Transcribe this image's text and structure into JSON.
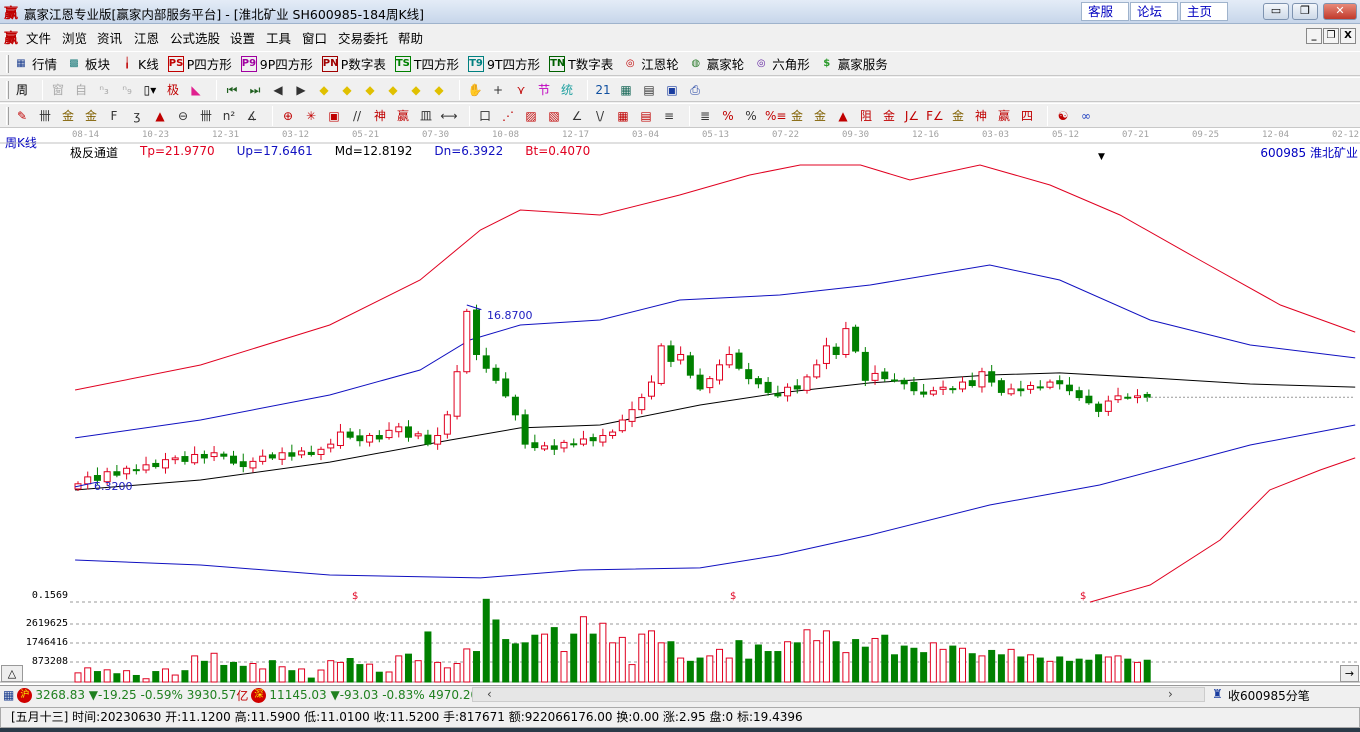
{
  "window": {
    "title": "赢家江恩专业版[赢家内部服务平台] - [淮北矿业  SH600985-184周K线]",
    "links": [
      "客服",
      "论坛",
      "主页"
    ],
    "controls": [
      "minimize",
      "restore",
      "close"
    ]
  },
  "menu": {
    "items": [
      "文件",
      "浏览",
      "资讯",
      "江恩",
      "公式选股",
      "设置",
      "工具",
      "窗口",
      "交易委托",
      "帮助"
    ]
  },
  "toolbar1": [
    {
      "label": "行情",
      "icon": "grid-icon",
      "glyph": "▦",
      "color": "#1a3d8f"
    },
    {
      "label": "板块",
      "icon": "blocks-icon",
      "glyph": "▩",
      "color": "#1a7a7a"
    },
    {
      "label": "K线",
      "icon": "kline-icon",
      "glyph": "╽",
      "color": "#c00000"
    },
    {
      "label": "P四方形",
      "icon": "ps-icon",
      "glyph": "PS",
      "color": "#c00000"
    },
    {
      "label": "9P四方形",
      "icon": "p9-icon",
      "glyph": "P9",
      "color": "#a000a0"
    },
    {
      "label": "P数字表",
      "icon": "pn-icon",
      "glyph": "PN",
      "color": "#a00000"
    },
    {
      "label": "T四方形",
      "icon": "ts-icon",
      "glyph": "TS",
      "color": "#008000"
    },
    {
      "label": "9T四方形",
      "icon": "t9-icon",
      "glyph": "T9",
      "color": "#008080"
    },
    {
      "label": "T数字表",
      "icon": "tn-icon",
      "glyph": "TN",
      "color": "#006000"
    },
    {
      "label": "江恩轮",
      "icon": "gann-wheel-icon",
      "glyph": "◎",
      "color": "#c00000"
    },
    {
      "label": "赢家轮",
      "icon": "winner-wheel-icon",
      "glyph": "◍",
      "color": "#2a7a2a"
    },
    {
      "label": "六角形",
      "icon": "hexagon-icon",
      "glyph": "◎",
      "color": "#6020a0"
    },
    {
      "label": "赢家服务",
      "icon": "dollar-icon",
      "glyph": "$",
      "color": "#2a9a2a"
    }
  ],
  "toolbar2": [
    {
      "name": "period-selector-icon",
      "glyph": "周▾",
      "color": "#000"
    },
    {
      "name": "sep"
    },
    {
      "name": "pattern-icon",
      "glyph": "窗",
      "color": "#aaa"
    },
    {
      "name": "self-icon",
      "glyph": "自",
      "color": "#aaa"
    },
    {
      "name": "n3-icon",
      "glyph": "ⁿ₃",
      "color": "#aaa"
    },
    {
      "name": "n9-icon",
      "glyph": "ⁿ₉",
      "color": "#aaa"
    },
    {
      "name": "candle-type-icon",
      "glyph": "▯▾",
      "color": "#000"
    },
    {
      "name": "extreme-icon",
      "glyph": "极",
      "color": "#c00000"
    },
    {
      "name": "histogram-icon",
      "glyph": "◣",
      "color": "#e0208f"
    },
    {
      "name": "sep"
    },
    {
      "name": "first-icon",
      "glyph": "⏮",
      "color": "#206020"
    },
    {
      "name": "last-icon",
      "glyph": "⏭",
      "color": "#206020"
    },
    {
      "name": "left-icon",
      "glyph": "◀",
      "color": "#333"
    },
    {
      "name": "right-icon",
      "glyph": "▶",
      "color": "#333"
    },
    {
      "name": "shift-left-icon",
      "glyph": "◆",
      "color": "#e0c000"
    },
    {
      "name": "shift-right-icon",
      "glyph": "◆",
      "color": "#e0c000"
    },
    {
      "name": "expand-icon",
      "glyph": "◆",
      "color": "#e0c000"
    },
    {
      "name": "shrink-icon",
      "glyph": "◆",
      "color": "#e0c000"
    },
    {
      "name": "zoom-v-icon",
      "glyph": "◆",
      "color": "#e0c000"
    },
    {
      "name": "zoom-all-icon",
      "glyph": "◆",
      "color": "#e0c000"
    },
    {
      "name": "sep"
    },
    {
      "name": "hand-icon",
      "glyph": "✋",
      "color": "#333"
    },
    {
      "name": "crosshair-icon",
      "glyph": "+",
      "color": "#333"
    },
    {
      "name": "draw-icon",
      "glyph": "⋎",
      "color": "#c00000"
    },
    {
      "name": "section-icon",
      "glyph": "节",
      "color": "#c000c0"
    },
    {
      "name": "stats-icon",
      "glyph": "统",
      "color": "#20a0a0"
    },
    {
      "name": "sep"
    },
    {
      "name": "calendar-icon",
      "glyph": "21",
      "color": "#1050a0"
    },
    {
      "name": "calculator-icon",
      "glyph": "▦",
      "color": "#1a6a5a"
    },
    {
      "name": "notes-icon",
      "glyph": "▤",
      "color": "#333"
    },
    {
      "name": "save-icon",
      "glyph": "▣",
      "color": "#1a3da0"
    },
    {
      "name": "print-icon",
      "glyph": "⎙",
      "color": "#1a3da0"
    }
  ],
  "toolbar3": [
    {
      "name": "pen-icon",
      "glyph": "✎",
      "color": "#c00000"
    },
    {
      "name": "lines-icon",
      "glyph": "卌",
      "color": "#333"
    },
    {
      "name": "gold-split-icon",
      "glyph": "金",
      "color": "#806000"
    },
    {
      "name": "gold-split2-icon",
      "glyph": "金",
      "color": "#806000"
    },
    {
      "name": "fibo-icon",
      "glyph": "F",
      "color": "#333"
    },
    {
      "name": "spiral-icon",
      "glyph": "ʒ",
      "color": "#333"
    },
    {
      "name": "marker-icon",
      "glyph": "▲",
      "color": "#c00000"
    },
    {
      "name": "circle-icon",
      "glyph": "⊖",
      "color": "#333"
    },
    {
      "name": "cycle-icon",
      "glyph": "卌",
      "color": "#333"
    },
    {
      "name": "n2-icon",
      "glyph": "n²",
      "color": "#333"
    },
    {
      "name": "angle-icon",
      "glyph": "∡",
      "color": "#333"
    },
    {
      "name": "sep"
    },
    {
      "name": "gann-circle-icon",
      "glyph": "⊕",
      "color": "#c00000"
    },
    {
      "name": "star-icon",
      "glyph": "✳",
      "color": "#c00000"
    },
    {
      "name": "square-icon",
      "glyph": "▣",
      "color": "#c00000"
    },
    {
      "name": "parallel-icon",
      "glyph": "//",
      "color": "#333"
    },
    {
      "name": "god-icon",
      "glyph": "神",
      "color": "#c00000"
    },
    {
      "name": "win-icon",
      "glyph": "赢",
      "color": "#c00000"
    },
    {
      "name": "time-grid-icon",
      "glyph": "皿",
      "color": "#333"
    },
    {
      "name": "range-icon",
      "glyph": "⟷",
      "color": "#333"
    },
    {
      "name": "sep"
    },
    {
      "name": "box-icon",
      "glyph": "口",
      "color": "#333"
    },
    {
      "name": "fan-icon",
      "glyph": "⋰",
      "color": "#c00000"
    },
    {
      "name": "fan-box-icon",
      "glyph": "▨",
      "color": "#c00000"
    },
    {
      "name": "fan-box2-icon",
      "glyph": "▧",
      "color": "#c00000"
    },
    {
      "name": "fan-lines-icon",
      "glyph": "∠",
      "color": "#333"
    },
    {
      "name": "wave-icon",
      "glyph": "\\/",
      "color": "#333"
    },
    {
      "name": "grid-red-icon",
      "glyph": "▦",
      "color": "#c00000"
    },
    {
      "name": "grid-diag-icon",
      "glyph": "▤",
      "color": "#c00000"
    },
    {
      "name": "hatch-icon",
      "glyph": "≡",
      "color": "#333"
    },
    {
      "name": "sep"
    },
    {
      "name": "ruler-icon",
      "glyph": "≣",
      "color": "#333"
    },
    {
      "name": "percent-line-icon",
      "glyph": "%",
      "color": "#c00000"
    },
    {
      "name": "percent-icon",
      "glyph": "%",
      "color": "#333"
    },
    {
      "name": "percent-levels-icon",
      "glyph": "%≡",
      "color": "#c00000"
    },
    {
      "name": "gold-circle-icon",
      "glyph": "金",
      "color": "#806000"
    },
    {
      "name": "gold-levels-icon",
      "glyph": "金",
      "color": "#806000"
    },
    {
      "name": "pen-level-icon",
      "glyph": "▲",
      "color": "#c00000"
    },
    {
      "name": "resistance-icon",
      "glyph": "阻",
      "color": "#c00000"
    },
    {
      "name": "gold-line-icon",
      "glyph": "金",
      "color": "#c00000"
    },
    {
      "name": "j-fan-icon",
      "glyph": "J∠",
      "color": "#c00000"
    },
    {
      "name": "f-fan-icon",
      "glyph": "F∠",
      "color": "#c00000"
    },
    {
      "name": "gold-fan-icon",
      "glyph": "金∠",
      "color": "#806000"
    },
    {
      "name": "god-fan-icon",
      "glyph": "神∠",
      "color": "#c00000"
    },
    {
      "name": "win-fan-icon",
      "glyph": "赢∠",
      "color": "#c00000"
    },
    {
      "name": "four-fan-icon",
      "glyph": "四∠",
      "color": "#c00000"
    },
    {
      "name": "sep"
    },
    {
      "name": "yinyang-icon",
      "glyph": "☯",
      "color": "#c00000"
    },
    {
      "name": "infinity-icon",
      "glyph": "∞",
      "color": "#2040c0"
    }
  ],
  "chart": {
    "period_label": "周K线",
    "stock_label": "600985 淮北矿业",
    "indicator": {
      "name": "极反通道",
      "tp": "Tp=21.9770",
      "up": "Up=17.6461",
      "md": "Md=12.8192",
      "dn": "Dn=6.3922",
      "bt": "Bt=0.4070"
    },
    "date_ticks": [
      "08-14",
      "10-23",
      "12-31",
      "03-12",
      "05-21",
      "07-30",
      "10-08",
      "12-17",
      "03-04",
      "05-13",
      "07-22",
      "09-30",
      "12-16",
      "03-03",
      "05-12",
      "07-21",
      "09-25",
      "12-04",
      "02-12"
    ],
    "high_marker": "16.8700",
    "low_marker": "6.3200",
    "volume_labels": [
      "0.1569",
      "2619625",
      "1746416",
      "873208"
    ],
    "dividend_marker": "$",
    "colors": {
      "up": "#e00020",
      "down": "#008000",
      "tp": "#e00020",
      "upper": "#1010c0",
      "mid": "#000000",
      "lower": "#1010c0",
      "bt": "#e00020"
    }
  },
  "chart_data": {
    "type": "candlestick",
    "title": "淮北矿业 SH600985 周K线",
    "close": [
      6.5,
      6.9,
      6.7,
      7.2,
      7.0,
      7.4,
      7.3,
      7.6,
      7.5,
      7.9,
      8.0,
      7.8,
      8.2,
      8.0,
      8.3,
      8.1,
      7.7,
      7.5,
      7.8,
      8.1,
      8.0,
      8.3,
      8.1,
      8.4,
      8.2,
      8.5,
      8.8,
      9.5,
      9.2,
      9.0,
      9.3,
      9.1,
      9.6,
      9.8,
      9.2,
      9.4,
      8.8,
      9.3,
      10.5,
      13.0,
      16.5,
      14.0,
      13.2,
      12.5,
      11.6,
      10.5,
      8.8,
      8.6,
      8.7,
      8.5,
      8.9,
      8.8,
      9.1,
      9.0,
      9.3,
      9.5,
      10.2,
      10.8,
      11.5,
      12.4,
      14.5,
      13.6,
      14.0,
      12.8,
      12.0,
      12.6,
      13.4,
      14.0,
      13.2,
      12.6,
      12.3,
      11.8,
      11.6,
      12.1,
      12.0,
      12.7,
      13.4,
      14.5,
      14.0,
      15.5,
      14.2,
      12.5,
      12.9,
      12.6,
      12.5,
      12.3,
      11.9,
      11.7,
      11.9,
      12.1,
      12.0,
      12.4,
      12.2,
      13.0,
      12.4,
      11.8,
      12.0,
      11.9,
      12.2,
      12.1,
      12.4,
      12.3,
      11.9,
      11.5,
      11.2,
      10.7,
      11.3,
      11.6,
      11.5,
      11.6,
      11.52
    ],
    "volume_k": [
      420,
      650,
      480,
      560,
      380,
      520,
      300,
      150,
      480,
      600,
      320,
      520,
      1200,
      950,
      1320,
      760,
      900,
      720,
      850,
      600,
      980,
      700,
      520,
      600,
      180,
      550,
      980,
      900,
      1080,
      800,
      820,
      450,
      460,
      1200,
      1280,
      980,
      2300,
      900,
      650,
      850,
      1520,
      1400,
      3800,
      2850,
      1950,
      1750,
      1800,
      2150,
      2200,
      2500,
      1400,
      2200,
      3000,
      2200,
      2700,
      1800,
      2050,
      800,
      2200,
      2350,
      1800,
      1850,
      1100,
      950,
      1100,
      1200,
      1500,
      1100,
      1900,
      1050,
      1700,
      1400,
      1400,
      1850,
      1800,
      2400,
      1900,
      2350,
      1850,
      1350,
      1950,
      1600,
      2000,
      2150,
      1250,
      1650,
      1550,
      1350,
      1800,
      1500,
      1650,
      1550,
      1300,
      1200,
      1450,
      1250,
      1500,
      1150,
      1250,
      1100,
      950,
      1150,
      950,
      1050,
      1000,
      1250,
      1150,
      1200,
      1050,
      900,
      1000,
      900,
      1650,
      1100
    ],
    "price_range": [
      -0.5,
      25.5
    ],
    "channel": {
      "tp": [
        [
          -0.3,
          11.94
        ],
        [
          12.6,
          13.39
        ],
        [
          25.9,
          15.71
        ],
        [
          35.2,
          18.32
        ],
        [
          41.4,
          21.22
        ],
        [
          45.5,
          22.38
        ],
        [
          53.7,
          22.09
        ],
        [
          61.9,
          23.25
        ],
        [
          69.1,
          24.41
        ],
        [
          74.3,
          24.99
        ],
        [
          80.5,
          24.99
        ],
        [
          85.6,
          24.12
        ],
        [
          92.8,
          24.99
        ],
        [
          100,
          23.83
        ],
        [
          107.2,
          22.09
        ],
        [
          115.4,
          19.48
        ],
        [
          123.7,
          16.87
        ],
        [
          131.4,
          15.3
        ]
      ],
      "up": [
        [
          -0.3,
          9.16
        ],
        [
          12.6,
          10.2
        ],
        [
          25.9,
          11.65
        ],
        [
          35.2,
          13.1
        ],
        [
          40.3,
          14.84
        ],
        [
          45.5,
          15.71
        ],
        [
          53.7,
          16.0
        ],
        [
          61.9,
          17.16
        ],
        [
          72.2,
          17.45
        ],
        [
          81.5,
          18.03
        ],
        [
          93.8,
          19.19
        ],
        [
          101,
          18.32
        ],
        [
          110.3,
          16.0
        ],
        [
          120.6,
          14.55
        ],
        [
          131.4,
          13.8
        ]
      ],
      "md": [
        [
          -0.3,
          6.14
        ],
        [
          12.6,
          6.72
        ],
        [
          25.9,
          7.76
        ],
        [
          38.3,
          9.04
        ],
        [
          45.5,
          9.74
        ],
        [
          53.7,
          9.91
        ],
        [
          64,
          11.07
        ],
        [
          72.2,
          11.77
        ],
        [
          81.5,
          12.35
        ],
        [
          93.8,
          12.81
        ],
        [
          101,
          12.93
        ],
        [
          110.3,
          12.64
        ],
        [
          120.6,
          12.29
        ],
        [
          131.4,
          12.11
        ]
      ],
      "dn": [
        [
          -0.3,
          2.08
        ],
        [
          12.6,
          1.79
        ],
        [
          25.9,
          1.21
        ],
        [
          41.4,
          1.04
        ],
        [
          51.6,
          1.5
        ],
        [
          64,
          1.62
        ],
        [
          72.2,
          2.37
        ],
        [
          81.5,
          3.53
        ],
        [
          93.8,
          5.27
        ],
        [
          105.1,
          6.43
        ],
        [
          120.6,
          8.75
        ],
        [
          131.4,
          9.91
        ]
      ],
      "bt": [
        [
          104.1,
          -0.36
        ],
        [
          110.3,
          0.63
        ],
        [
          117.5,
          3.24
        ],
        [
          122.6,
          6.14
        ],
        [
          127.8,
          7.3
        ],
        [
          131.4,
          8.0
        ]
      ]
    }
  },
  "index_bar": {
    "sh_badge": "沪",
    "sh": "3268.83 ▼-19.25 -0.59% 3930.57",
    "sh_unit": "亿",
    "sz_badge": "深",
    "sz": "11145.03 ▼-93.03 -0.83% 4970.20",
    "receive": "收600985分笔"
  },
  "status": {
    "text": "[五月十三] 时间:20230630 开:11.1200 高:11.5900 低:11.0100 收:11.5200 手:817671 额:922066176.00 换:0.00 涨:2.95 盘:0 标:19.4396"
  }
}
